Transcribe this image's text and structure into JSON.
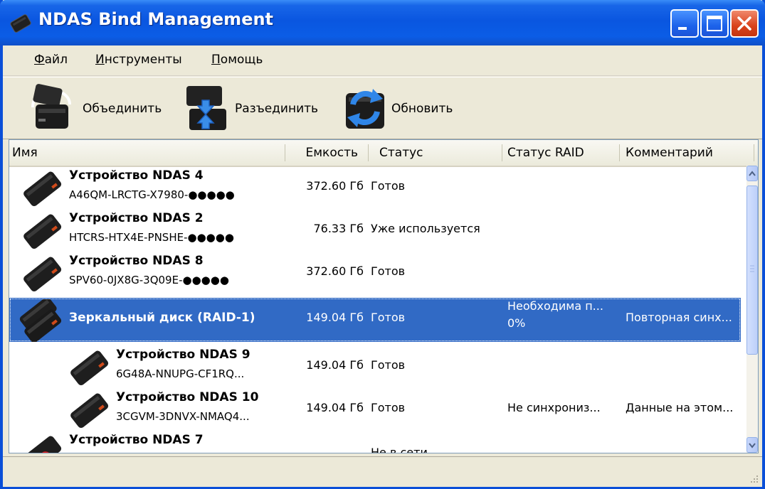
{
  "window": {
    "title": "NDAS Bind Management",
    "colors": {
      "titlebar": "#0a56e0",
      "selection": "#316ac5",
      "close": "#d9421b"
    }
  },
  "menu": {
    "items": [
      {
        "label": "Файл",
        "mnemonic": "Ф",
        "rest": "айл"
      },
      {
        "label": "Инструменты",
        "mnemonic": "И",
        "rest": "нструменты"
      },
      {
        "label": "Помощь",
        "mnemonic": "П",
        "rest": "омощь"
      }
    ]
  },
  "toolbar": {
    "bind_label": "Объединить",
    "unbind_label": "Разъединить",
    "refresh_label": "Обновить"
  },
  "table": {
    "columns": [
      "Имя",
      "Емкость",
      "Статус",
      "Статус RAID",
      "Комментарий"
    ],
    "rows": [
      {
        "name": "Устройство NDAS 4",
        "serial": "A46QM-LRCTG-X7980-●●●●●",
        "capacity": "372.60 Гб",
        "status": "Готов",
        "raid_status": "",
        "raid_status2": "",
        "comment": ""
      },
      {
        "name": "Устройство NDAS 2",
        "serial": "HTCRS-HTX4E-PNSHE-●●●●●",
        "capacity": "76.33 Гб",
        "status": "Уже используется",
        "raid_status": "",
        "raid_status2": "",
        "comment": ""
      },
      {
        "name": "Устройство NDAS 8",
        "serial": "SPV60-0JX8G-3Q09E-●●●●●",
        "capacity": "372.60 Гб",
        "status": "Готов",
        "raid_status": "",
        "raid_status2": "",
        "comment": ""
      },
      {
        "name": "Зеркальный диск (RAID-1)",
        "serial": "",
        "capacity": "149.04 Гб",
        "status": "Готов",
        "raid_status": "Необходима п...",
        "raid_status2": "0%",
        "comment": "Повторная синх..."
      },
      {
        "name": "Устройство NDAS 9",
        "serial": "6G48A-NNUPG-CF1RQ...",
        "capacity": "149.04 Гб",
        "status": "Готов",
        "raid_status": "",
        "raid_status2": "",
        "comment": ""
      },
      {
        "name": "Устройство NDAS 10",
        "serial": "3CGVM-3DNVX-NMAQ4...",
        "capacity": "149.04 Гб",
        "status": "Готов",
        "raid_status": "Не синхрониз...",
        "raid_status2": "",
        "comment": "Данные на этом..."
      },
      {
        "name": "Устройство NDAS 7",
        "serial": "",
        "capacity": "",
        "status": "Не в сети",
        "raid_status": "",
        "raid_status2": "",
        "comment": ""
      }
    ]
  },
  "icons": {
    "app": "ndas-device-icon",
    "bind": "bind-disk-icon",
    "unbind": "unbind-disk-icon",
    "refresh": "refresh-disk-icon",
    "device": "ndas-disk-icon",
    "offline_device": "ndas-disk-offline-icon",
    "raid": "raid-mirror-icon"
  }
}
